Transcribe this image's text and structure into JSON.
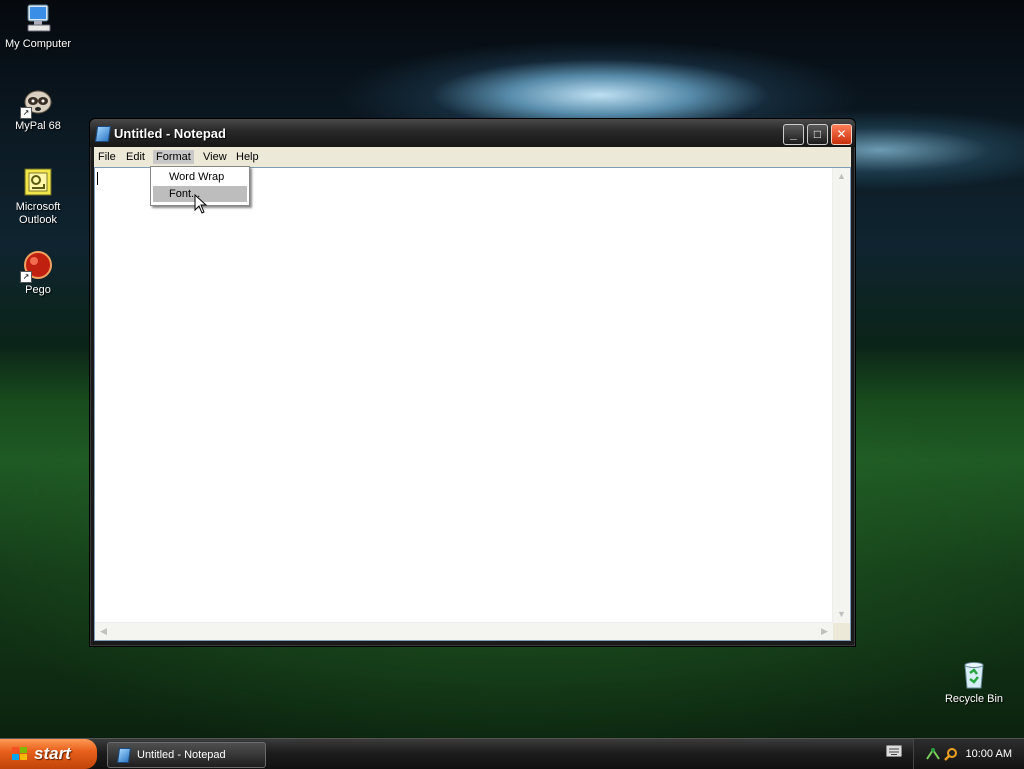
{
  "desktop": {
    "icons": [
      {
        "label": "My Computer",
        "icon": "my-computer-icon"
      },
      {
        "label": "MyPal 68",
        "icon": "mypal-browser-icon"
      },
      {
        "label": "Microsoft Outlook",
        "icon": "outlook-icon"
      },
      {
        "label": "Pego",
        "icon": "pego-icon"
      },
      {
        "label": "Recycle Bin",
        "icon": "recycle-bin-icon"
      }
    ]
  },
  "window": {
    "title": "Untitled - Notepad",
    "icon": "notepad-icon",
    "buttons": {
      "minimize": "_",
      "maximize": "□",
      "close": "✕"
    },
    "menu": [
      {
        "label": "File"
      },
      {
        "label": "Edit"
      },
      {
        "label": "Format"
      },
      {
        "label": "View"
      },
      {
        "label": "Help"
      }
    ],
    "active_menu": "Format",
    "editor_text": ""
  },
  "dropdown": {
    "items": [
      {
        "label": "Word Wrap"
      },
      {
        "label": "Font..."
      }
    ],
    "highlighted": "Font..."
  },
  "taskbar": {
    "start_label": "start",
    "tasks": [
      {
        "label": "Untitled - Notepad",
        "icon": "notepad-icon"
      }
    ],
    "clock": "10:00 AM"
  },
  "colors": {
    "start_button": "#e8601c",
    "close_button": "#c8300a",
    "menu_highlight": "#bdbdbd"
  }
}
